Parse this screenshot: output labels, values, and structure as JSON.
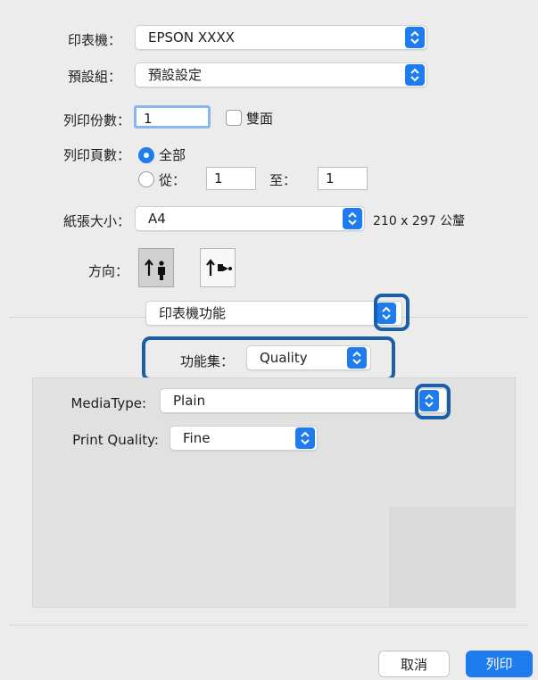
{
  "dialog": {
    "printer": {
      "label": "印表機：",
      "value": "EPSON XXXX"
    },
    "presets": {
      "label": "預設組：",
      "value": "預設設定"
    },
    "copies": {
      "label": "列印份數：",
      "value": "1",
      "two_sided_label": "雙面",
      "two_sided_checked": false
    },
    "pages": {
      "label": "列印頁數：",
      "all_label": "全部",
      "from_label": "從：",
      "from_value": "1",
      "to_label": "至：",
      "to_value": "1",
      "selected": "all"
    },
    "paper_size": {
      "label": "紙張大小：",
      "value": "A4",
      "dimensions": "210 x 297 公釐"
    },
    "orientation": {
      "label": "方向：",
      "selected": "portrait"
    },
    "panel_select": {
      "value": "印表機功能"
    },
    "feature_set": {
      "label": "功能集：",
      "value": "Quality"
    },
    "media_type": {
      "label": "MediaType:",
      "value": "Plain"
    },
    "print_quality": {
      "label": "Print Quality:",
      "value": "Fine"
    },
    "buttons": {
      "cancel": "取消",
      "print": "列印"
    }
  },
  "colors": {
    "accent": "#1f7cf0",
    "callout_border": "#1b5fa8",
    "window_bg": "#ececec",
    "panel_bg": "#e1e1e1"
  },
  "icons": {
    "popup_stepper": "up-down-chevron-icon",
    "portrait": "portrait-orientation-icon",
    "landscape": "landscape-orientation-icon"
  }
}
